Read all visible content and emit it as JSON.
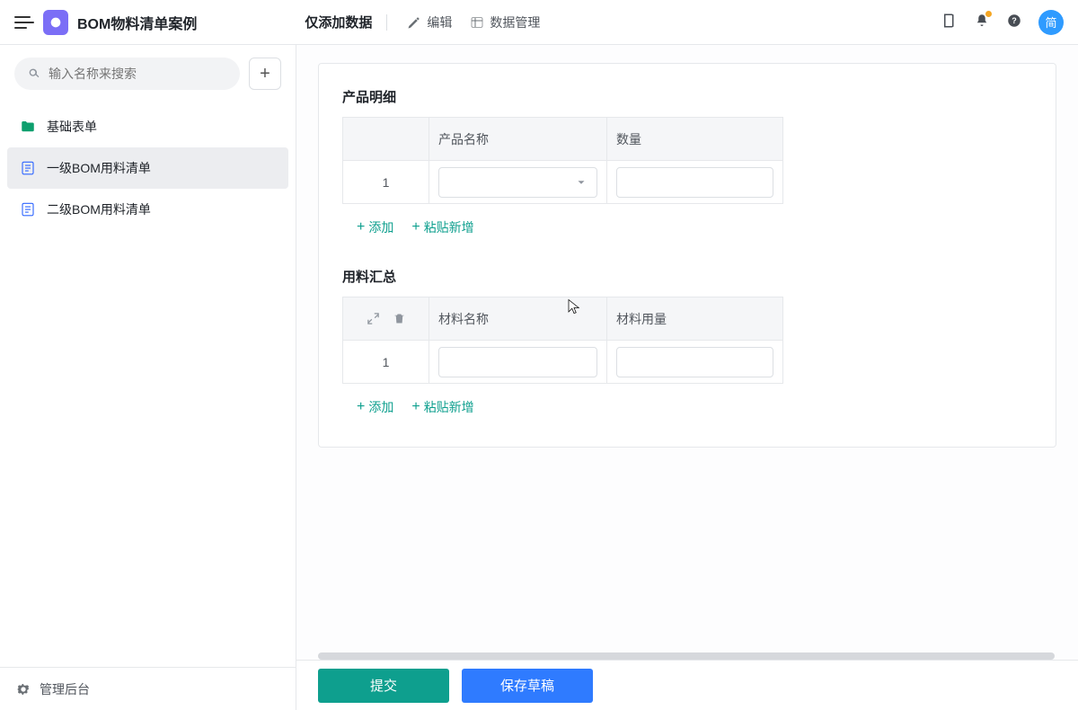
{
  "header": {
    "app_title": "BOM物料清单案例",
    "mode_label": "仅添加数据",
    "edit_label": "编辑",
    "data_manage_label": "数据管理",
    "avatar_text": "简"
  },
  "sidebar": {
    "search_placeholder": "输入名称来搜索",
    "items": [
      {
        "label": "基础表单",
        "kind": "folder"
      },
      {
        "label": "一级BOM用料清单",
        "kind": "form",
        "active": true
      },
      {
        "label": "二级BOM用料清单",
        "kind": "form"
      }
    ],
    "admin_label": "管理后台"
  },
  "sections": {
    "product": {
      "title": "产品明细",
      "cols": {
        "name": "产品名称",
        "qty": "数量"
      },
      "row_number": "1",
      "add_label": "添加",
      "paste_add_label": "粘贴新增"
    },
    "materials": {
      "title": "用料汇总",
      "cols": {
        "name": "材料名称",
        "usage": "材料用量"
      },
      "row_number": "1",
      "add_label": "添加",
      "paste_add_label": "粘贴新增"
    }
  },
  "footer": {
    "submit": "提交",
    "save_draft": "保存草稿"
  }
}
